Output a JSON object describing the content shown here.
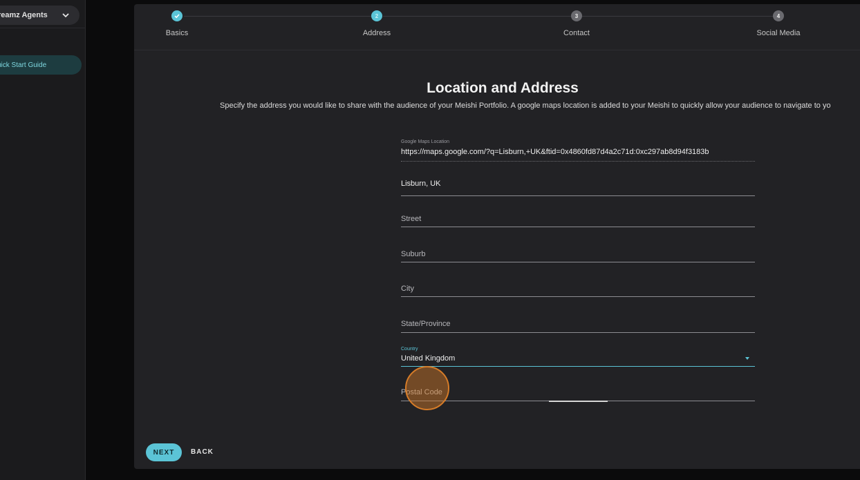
{
  "sidebar": {
    "workspace_label": "reamz Agents",
    "quick_start_label": "uick Start Guide"
  },
  "stepper": {
    "steps": [
      {
        "label": "Basics",
        "number": "",
        "state": "done"
      },
      {
        "label": "Address",
        "number": "2",
        "state": "active"
      },
      {
        "label": "Contact",
        "number": "3",
        "state": "todo"
      },
      {
        "label": "Social Media",
        "number": "4",
        "state": "todo"
      }
    ]
  },
  "page": {
    "title": "Location and Address",
    "description": "Specify the address you would like to share with the audience of your Meishi Portfolio. A google maps location is added to your Meishi to quickly allow your audience to navigate to yo"
  },
  "form": {
    "maps": {
      "label": "Google Maps Location",
      "value": "https://maps.google.com/?q=Lisburn,+UK&ftid=0x4860fd87d4a2c71d:0xc297ab8d94f3183b"
    },
    "search": {
      "value": "Lisburn, UK"
    },
    "street": {
      "placeholder": "Street"
    },
    "suburb": {
      "placeholder": "Suburb"
    },
    "city": {
      "placeholder": "City"
    },
    "state": {
      "placeholder": "State/Province"
    },
    "country": {
      "label": "Country",
      "value": "United Kingdom"
    },
    "postal": {
      "placeholder": "Postal Code"
    }
  },
  "actions": {
    "next_label": "NEXT",
    "back_label": "BACK"
  },
  "colors": {
    "accent": "#5bc4d6",
    "click_highlight": "#d67c28"
  }
}
